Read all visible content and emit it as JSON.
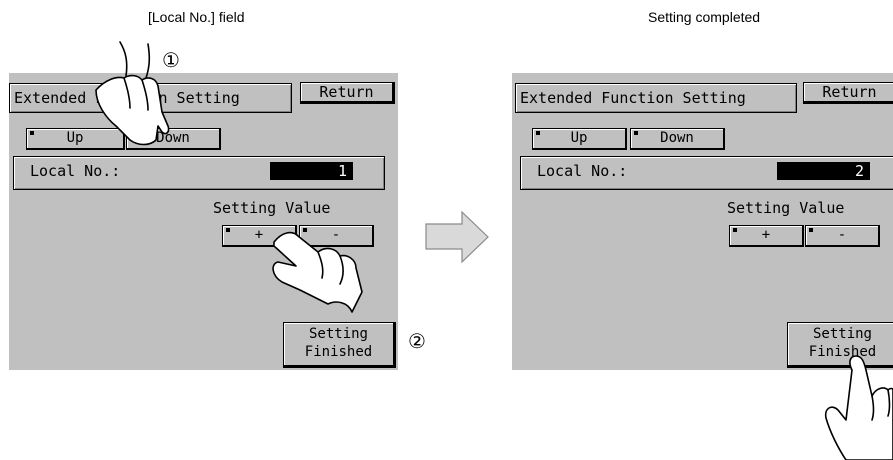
{
  "captions": {
    "left": "[Local No.] field",
    "right": "Setting completed"
  },
  "steps": {
    "one": "①",
    "two": "②"
  },
  "left_screen": {
    "title": "Extended Function Setting",
    "return_label": "Return",
    "up_label": "Up",
    "down_label": "Down",
    "local_label": "Local No.:",
    "local_value": "1",
    "setting_value_label": "Setting Value",
    "plus_label": "+",
    "minus_label": "-",
    "finish_label": "Setting\nFinished"
  },
  "right_screen": {
    "title": "Extended Function Setting",
    "return_label": "Return",
    "up_label": "Up",
    "down_label": "Down",
    "local_label": "Local No.:",
    "local_value": "2",
    "setting_value_label": "Setting Value",
    "plus_label": "+",
    "minus_label": "-",
    "finish_label": "Setting\nFinished"
  },
  "colors": {
    "panel": "#c0c0c0",
    "arrow": "#d9d9d9",
    "value_bg": "#000000"
  }
}
